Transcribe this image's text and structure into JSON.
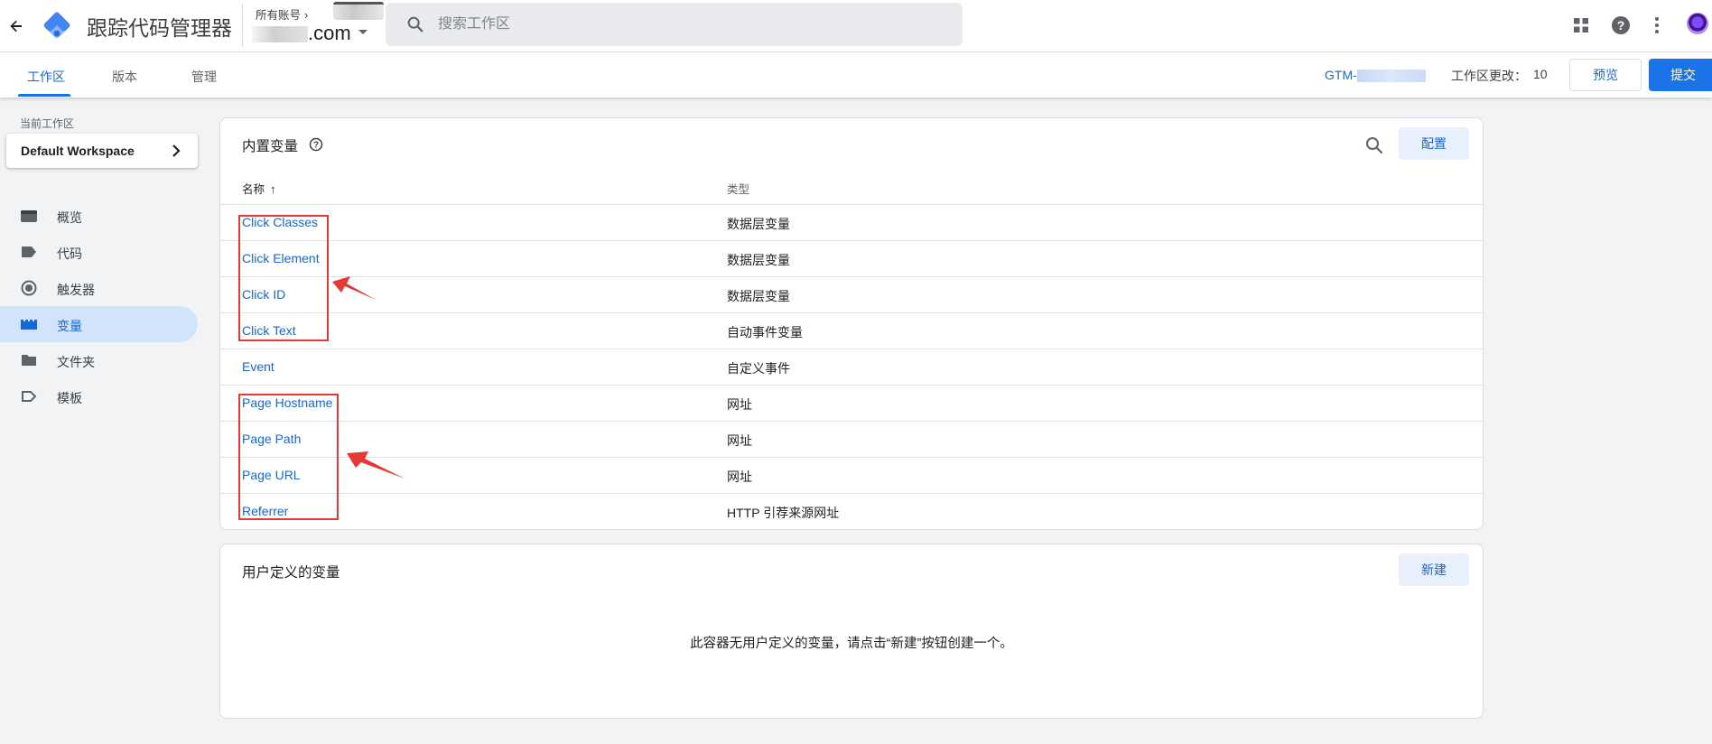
{
  "app": {
    "title": "跟踪代码管理器",
    "account_label": "所有账号",
    "container_suffix": ".com",
    "search_placeholder": "搜索工作区"
  },
  "tabs": [
    {
      "label": "工作区",
      "active": true
    },
    {
      "label": "版本",
      "active": false
    },
    {
      "label": "管理",
      "active": false
    }
  ],
  "header_right": {
    "gtm_id_prefix": "GTM-",
    "workspace_changes_label": "工作区更改：",
    "workspace_changes_count": "10",
    "preview_label": "预览",
    "submit_label": "提交"
  },
  "sidebar": {
    "current_workspace_label": "当前工作区",
    "workspace_name": "Default Workspace",
    "items": [
      {
        "label": "概览",
        "icon": "overview-icon",
        "active": false
      },
      {
        "label": "代码",
        "icon": "tag-icon",
        "active": false
      },
      {
        "label": "触发器",
        "icon": "trigger-icon",
        "active": false
      },
      {
        "label": "变量",
        "icon": "variable-icon",
        "active": true
      },
      {
        "label": "文件夹",
        "icon": "folder-icon",
        "active": false
      },
      {
        "label": "模板",
        "icon": "template-icon",
        "active": false
      }
    ]
  },
  "builtin": {
    "title": "内置变量",
    "configure_label": "配置",
    "columns": {
      "name": "名称",
      "type": "类型"
    },
    "rows": [
      {
        "name": "Click Classes",
        "type": "数据层变量"
      },
      {
        "name": "Click Element",
        "type": "数据层变量"
      },
      {
        "name": "Click ID",
        "type": "数据层变量"
      },
      {
        "name": "Click Text",
        "type": "自动事件变量"
      },
      {
        "name": "Event",
        "type": "自定义事件"
      },
      {
        "name": "Page Hostname",
        "type": "网址"
      },
      {
        "name": "Page Path",
        "type": "网址"
      },
      {
        "name": "Page URL",
        "type": "网址"
      },
      {
        "name": "Referrer",
        "type": "HTTP 引荐来源网址"
      }
    ]
  },
  "user_defined": {
    "title": "用户定义的变量",
    "new_label": "新建",
    "empty_message": "此容器无用户定义的变量，请点击“新建”按钮创建一个。"
  },
  "colors": {
    "accent": "#1a73e8",
    "link": "#1967d2",
    "active_nav_bg": "#d2e3fc",
    "annotation_red": "#e53935"
  }
}
